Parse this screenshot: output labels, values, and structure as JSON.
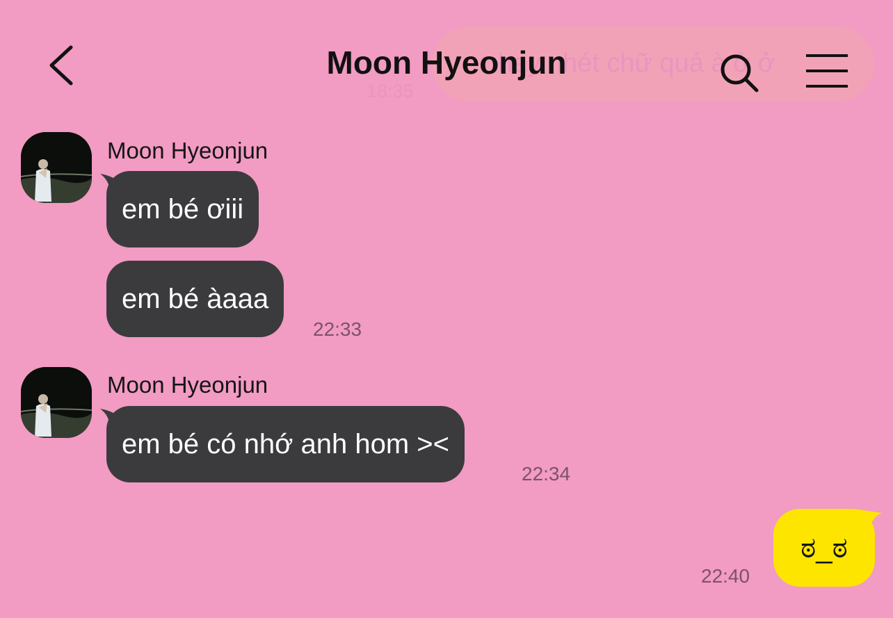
{
  "header": {
    "title": "Moon Hyeonjun",
    "back_icon": "chevron-left-icon",
    "search_icon": "search-icon",
    "menu_icon": "hamburger-menu-icon"
  },
  "previous_message": {
    "text": "hay nhét chữ quá à ở ở",
    "time": "18:35"
  },
  "groups": [
    {
      "sender": "Moon Hyeonjun",
      "messages": [
        "em bé ơiii",
        "em bé àaaa"
      ],
      "time": "22:33"
    },
    {
      "sender": "Moon Hyeonjun",
      "messages": [
        "em bé có nhớ anh hom ><"
      ],
      "time": "22:34"
    }
  ],
  "my_message": {
    "text": "ಠ_ಠ",
    "time": "22:40"
  },
  "colors": {
    "background": "#f29bc3",
    "incoming_bubble": "#3b3b3d",
    "outgoing_bubble": "#fee500"
  }
}
